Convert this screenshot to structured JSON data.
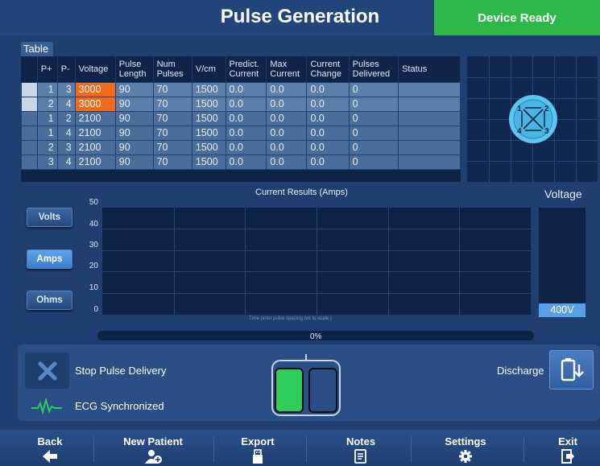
{
  "header": {
    "title": "Pulse Generation",
    "status": "Device Ready"
  },
  "table": {
    "tab_label": "Table",
    "columns": [
      "",
      "P+",
      "P-",
      "Voltage",
      "Pulse Length",
      "Num Pulses",
      "V/cm",
      "Predict. Current",
      "Max Current",
      "Current Change",
      "Pulses Delivered",
      "Status"
    ],
    "rows": [
      [
        "",
        "1",
        "3",
        "3000",
        "90",
        "70",
        "1500",
        "0.0",
        "0.0",
        "0.0",
        "0",
        ""
      ],
      [
        "",
        "2",
        "4",
        "3000",
        "90",
        "70",
        "1500",
        "0.0",
        "0.0",
        "0.0",
        "0",
        ""
      ],
      [
        "",
        "1",
        "2",
        "2100",
        "90",
        "70",
        "1500",
        "0.0",
        "0.0",
        "0.0",
        "0",
        ""
      ],
      [
        "",
        "1",
        "4",
        "2100",
        "90",
        "70",
        "1500",
        "0.0",
        "0.0",
        "0.0",
        "0",
        ""
      ],
      [
        "",
        "2",
        "3",
        "2100",
        "90",
        "70",
        "1500",
        "0.0",
        "0.0",
        "0.0",
        "0",
        ""
      ],
      [
        "",
        "3",
        "4",
        "2100",
        "90",
        "70",
        "1500",
        "0.0",
        "0.0",
        "0.0",
        "0",
        ""
      ]
    ]
  },
  "electrode": {
    "labels": [
      "1",
      "2",
      "3",
      "4"
    ]
  },
  "chart": {
    "title": "Current Results (Amps)",
    "y_ticks": [
      "50",
      "40",
      "30",
      "20",
      "10",
      "0"
    ],
    "x_label": "Time (inter pulse spacing not to scale.)",
    "buttons": {
      "volts": "Volts",
      "amps": "Amps",
      "ohms": "Ohms"
    },
    "active_button": "amps"
  },
  "voltage": {
    "label": "Voltage",
    "value": "400V"
  },
  "progress": {
    "label": "0%",
    "fraction": 0
  },
  "delivery": {
    "stop_label": "Stop Pulse Delivery",
    "ecg_label": "ECG Synchronized",
    "discharge_label": "Discharge"
  },
  "nav": {
    "back": "Back",
    "new_patient": "New Patient",
    "export": "Export",
    "notes": "Notes",
    "settings": "Settings",
    "exit": "Exit"
  },
  "colors": {
    "ready": "#2eb84a",
    "highlight": "#f26a1a",
    "active_button": "#5fa3e8"
  }
}
